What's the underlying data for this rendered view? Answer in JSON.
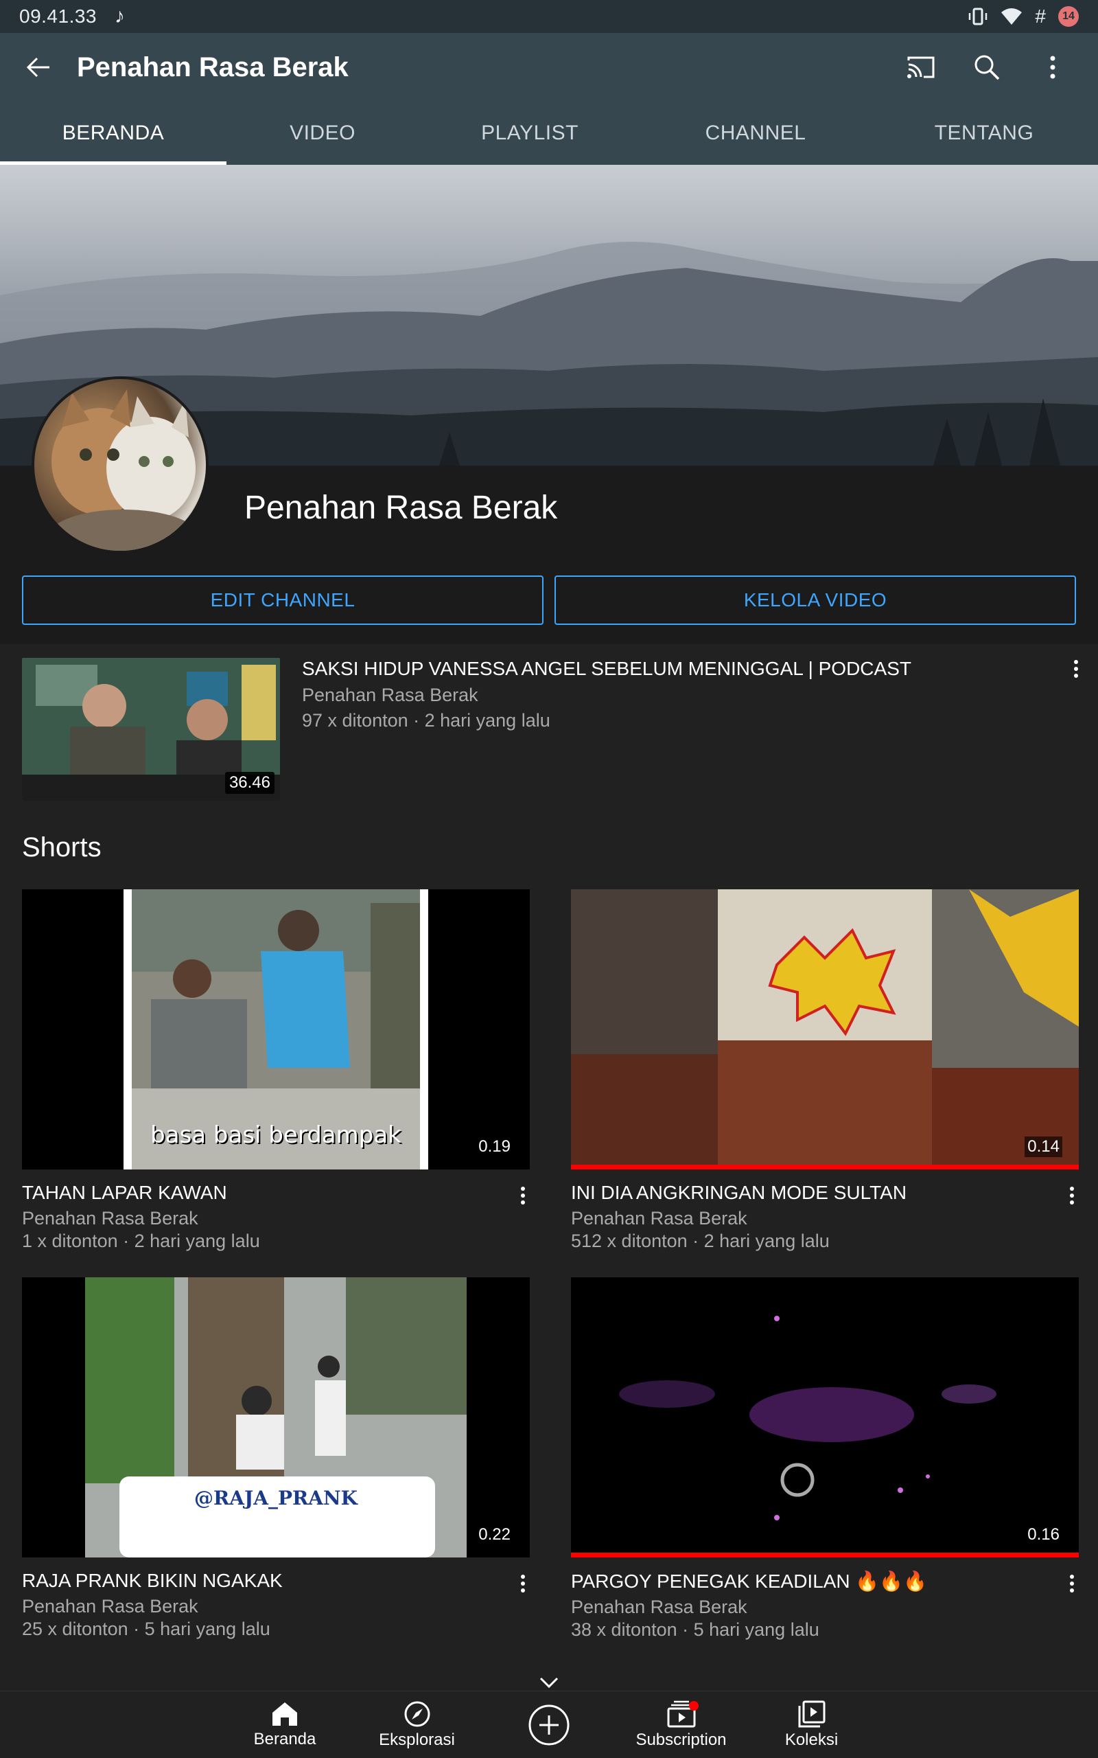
{
  "status_bar": {
    "time": "09.41.33",
    "note_icon": "♪",
    "hash": "#",
    "badge": "14"
  },
  "app_bar": {
    "title": "Penahan Rasa Berak"
  },
  "tabs": [
    {
      "label": "BERANDA",
      "active": true
    },
    {
      "label": "VIDEO",
      "active": false
    },
    {
      "label": "PLAYLIST",
      "active": false
    },
    {
      "label": "CHANNEL",
      "active": false
    },
    {
      "label": "TENTANG",
      "active": false
    }
  ],
  "channel": {
    "name": "Penahan Rasa Berak",
    "edit_button": "EDIT CHANNEL",
    "manage_button": "KELOLA VIDEO"
  },
  "featured_video": {
    "title": "SAKSI HIDUP VANESSA ANGEL SEBELUM MENINGGAL | PODCAST",
    "channel": "Penahan Rasa Berak",
    "meta": "97 x ditonton · 2 hari yang lalu",
    "duration": "36.46"
  },
  "shorts": {
    "section_title": "Shorts",
    "items": [
      {
        "title": "TAHAN LAPAR KAWAN",
        "channel": "Penahan Rasa Berak",
        "meta": "1 x ditonton · 2 hari yang lalu",
        "duration": "0.19",
        "watched_fraction": 0,
        "overlay_text": "basa basi berdampak"
      },
      {
        "title": "INI DIA ANGKRINGAN MODE SULTAN",
        "channel": "Penahan Rasa Berak",
        "meta": "512 x ditonton · 2 hari yang lalu",
        "duration": "0.14",
        "watched_fraction": 1.0,
        "overlay_text": ""
      },
      {
        "title": "RAJA PRANK BIKIN NGAKAK",
        "channel": "Penahan Rasa Berak",
        "meta": "25 x ditonton · 5 hari yang lalu",
        "duration": "0.22",
        "watched_fraction": 0,
        "overlay_text": "@RAJA_PRANK"
      },
      {
        "title": "PARGOY PENEGAK KEADILAN 🔥🔥🔥",
        "channel": "Penahan Rasa Berak",
        "meta": "38 x ditonton · 5 hari yang lalu",
        "duration": "0.16",
        "watched_fraction": 1.0,
        "overlay_text": ""
      }
    ]
  },
  "bottom_nav": [
    {
      "label": "Beranda",
      "icon": "home-icon"
    },
    {
      "label": "Eksplorasi",
      "icon": "explore-icon"
    },
    {
      "label": "",
      "icon": "create-icon"
    },
    {
      "label": "Subscription",
      "icon": "subscriptions-icon"
    },
    {
      "label": "Koleksi",
      "icon": "library-icon"
    }
  ],
  "colors": {
    "app_bar": "#37474f",
    "status_bar": "#263238",
    "accent_blue": "#3ea6ff",
    "progress_red": "#ff0000"
  }
}
